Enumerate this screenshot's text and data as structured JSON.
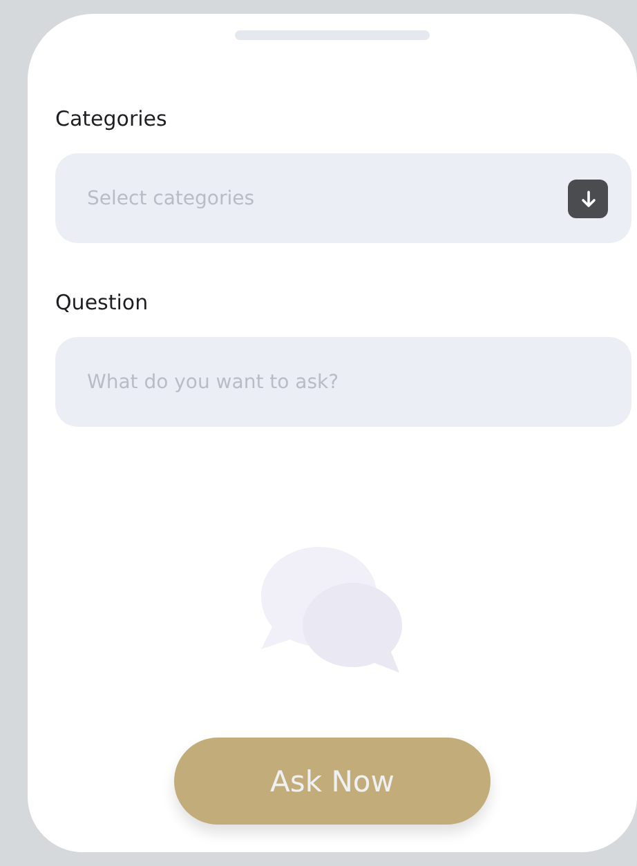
{
  "form": {
    "fields": [
      {
        "kind": "select",
        "label": "Categories",
        "placeholder": "Select categories"
      },
      {
        "kind": "text",
        "label": "Question",
        "placeholder": "What do you want to ask?"
      }
    ]
  },
  "button": {
    "label": "Ask Now"
  }
}
